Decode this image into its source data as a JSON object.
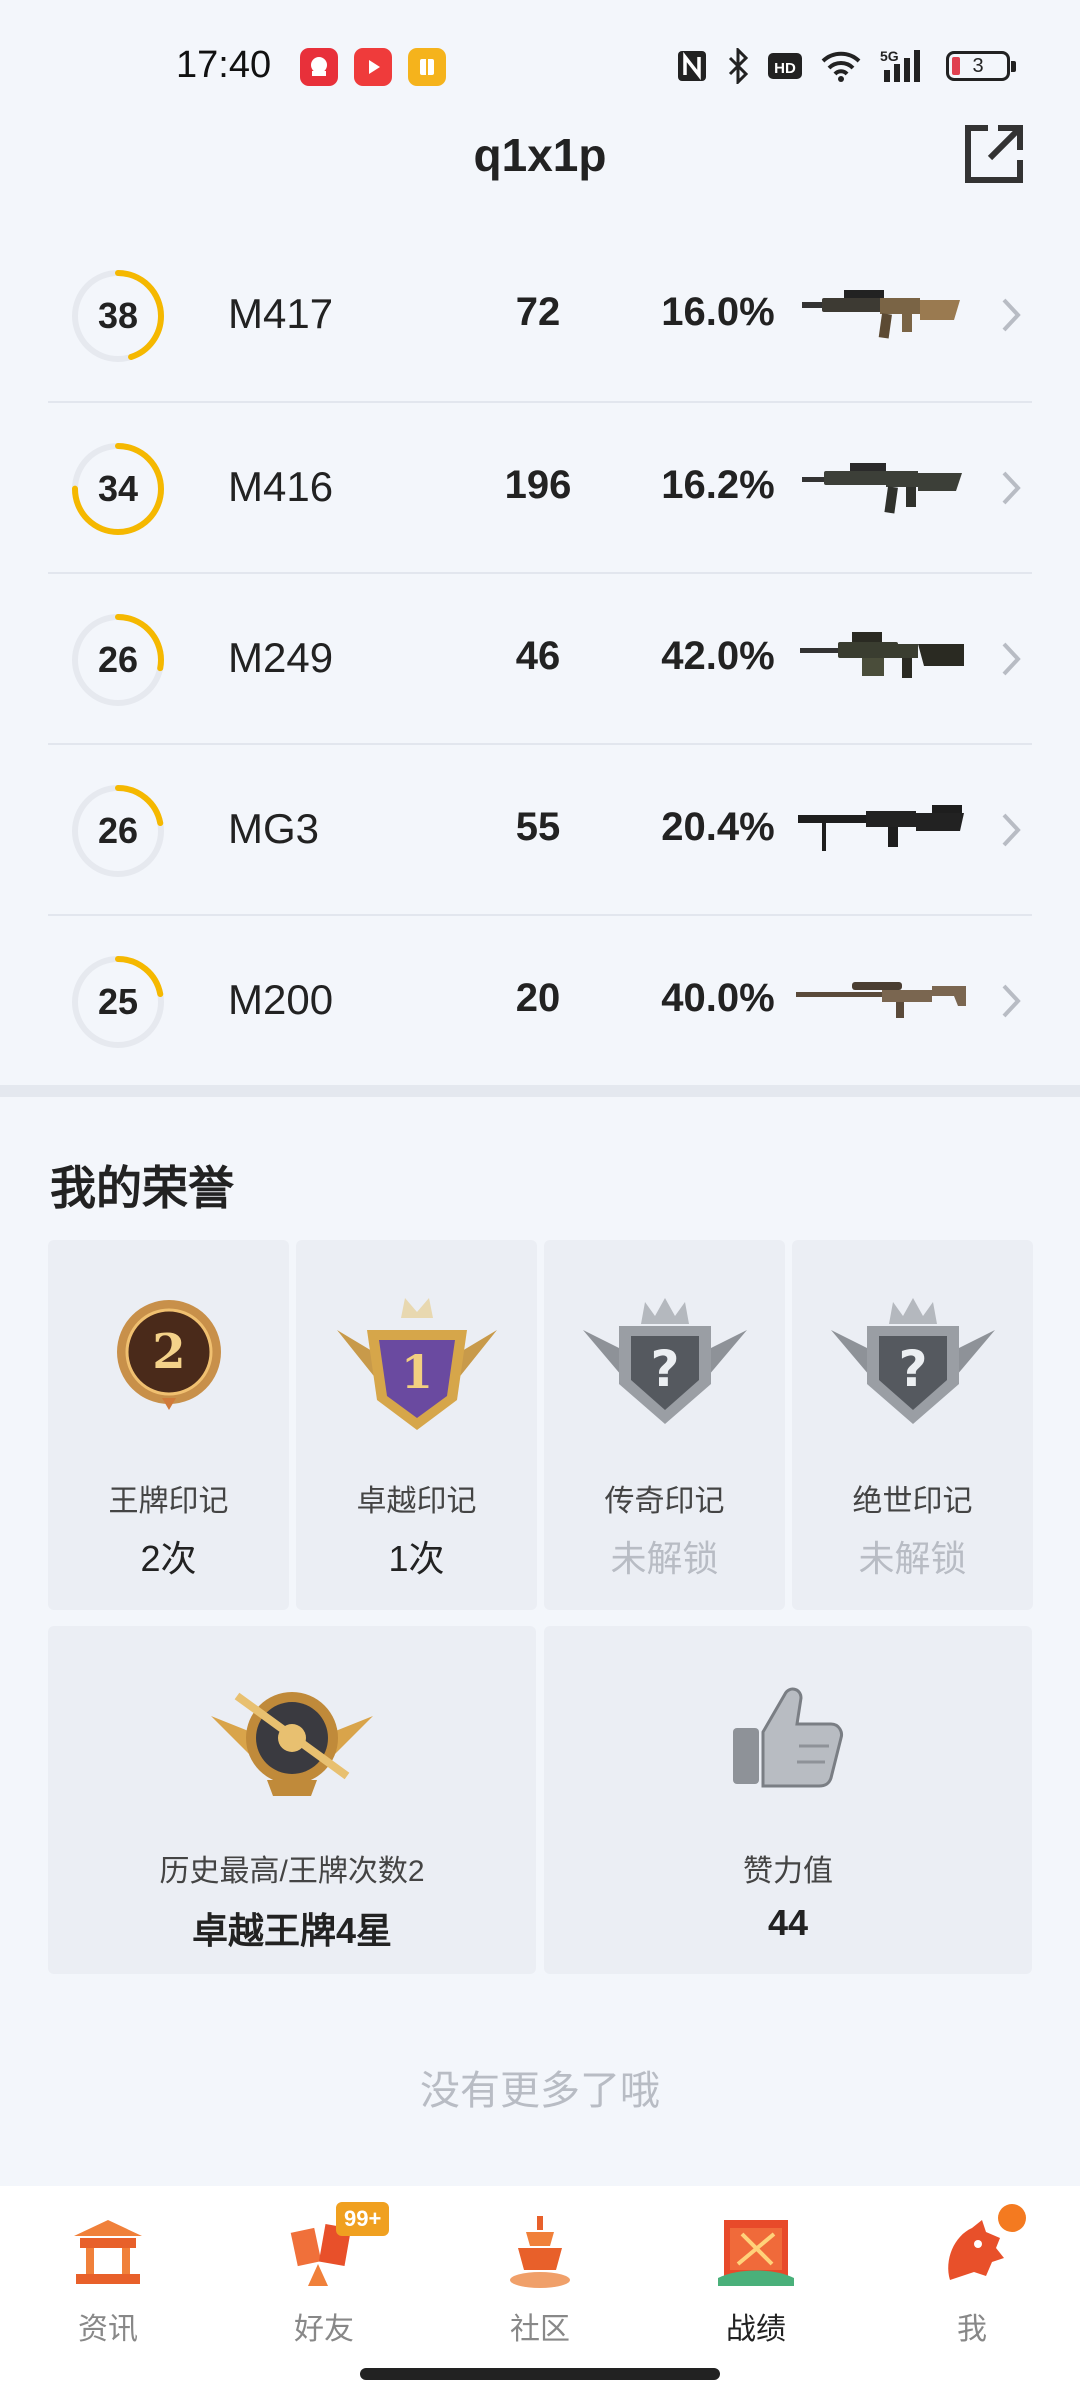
{
  "status_bar": {
    "time": "17:40",
    "battery_level": "3",
    "icons": [
      "nfc-icon",
      "bluetooth-icon",
      "hd-icon",
      "wifi-icon",
      "5g-signal-icon",
      "battery-icon"
    ]
  },
  "header": {
    "title": "q1x1p"
  },
  "weapons": [
    {
      "level": "38",
      "name": "M417",
      "kills": "72",
      "rate": "16.0%",
      "progress": 0.45
    },
    {
      "level": "34",
      "name": "M416",
      "kills": "196",
      "rate": "16.2%",
      "progress": 0.75
    },
    {
      "level": "26",
      "name": "M249",
      "kills": "46",
      "rate": "42.0%",
      "progress": 0.28
    },
    {
      "level": "26",
      "name": "MG3",
      "kills": "55",
      "rate": "20.4%",
      "progress": 0.22
    },
    {
      "level": "25",
      "name": "M200",
      "kills": "20",
      "rate": "40.0%",
      "progress": 0.22
    }
  ],
  "honors": {
    "title": "我的荣誉",
    "marks": [
      {
        "label": "王牌印记",
        "value": "2次",
        "locked": false,
        "badge_number": "2"
      },
      {
        "label": "卓越印记",
        "value": "1次",
        "locked": false,
        "badge_number": "1"
      },
      {
        "label": "传奇印记",
        "value": "未解锁",
        "locked": true,
        "badge_number": "?"
      },
      {
        "label": "绝世印记",
        "value": "未解锁",
        "locked": true,
        "badge_number": "?"
      }
    ],
    "stats": [
      {
        "label": "历史最高/王牌次数2",
        "value": "卓越王牌4星"
      },
      {
        "label": "赞力值",
        "value": "44"
      }
    ]
  },
  "footer_text": "没有更多了哦",
  "bottom_nav": {
    "items": [
      {
        "label": "资讯",
        "active": false
      },
      {
        "label": "好友",
        "active": false,
        "badge": "99+"
      },
      {
        "label": "社区",
        "active": false
      },
      {
        "label": "战绩",
        "active": true
      },
      {
        "label": "我",
        "active": false,
        "dot": true
      }
    ]
  },
  "colors": {
    "ring_progress": "#f5b800",
    "ring_track": "#e6e9ef",
    "accent_orange": "#f47a20",
    "badge_bg": "#f0a020"
  }
}
